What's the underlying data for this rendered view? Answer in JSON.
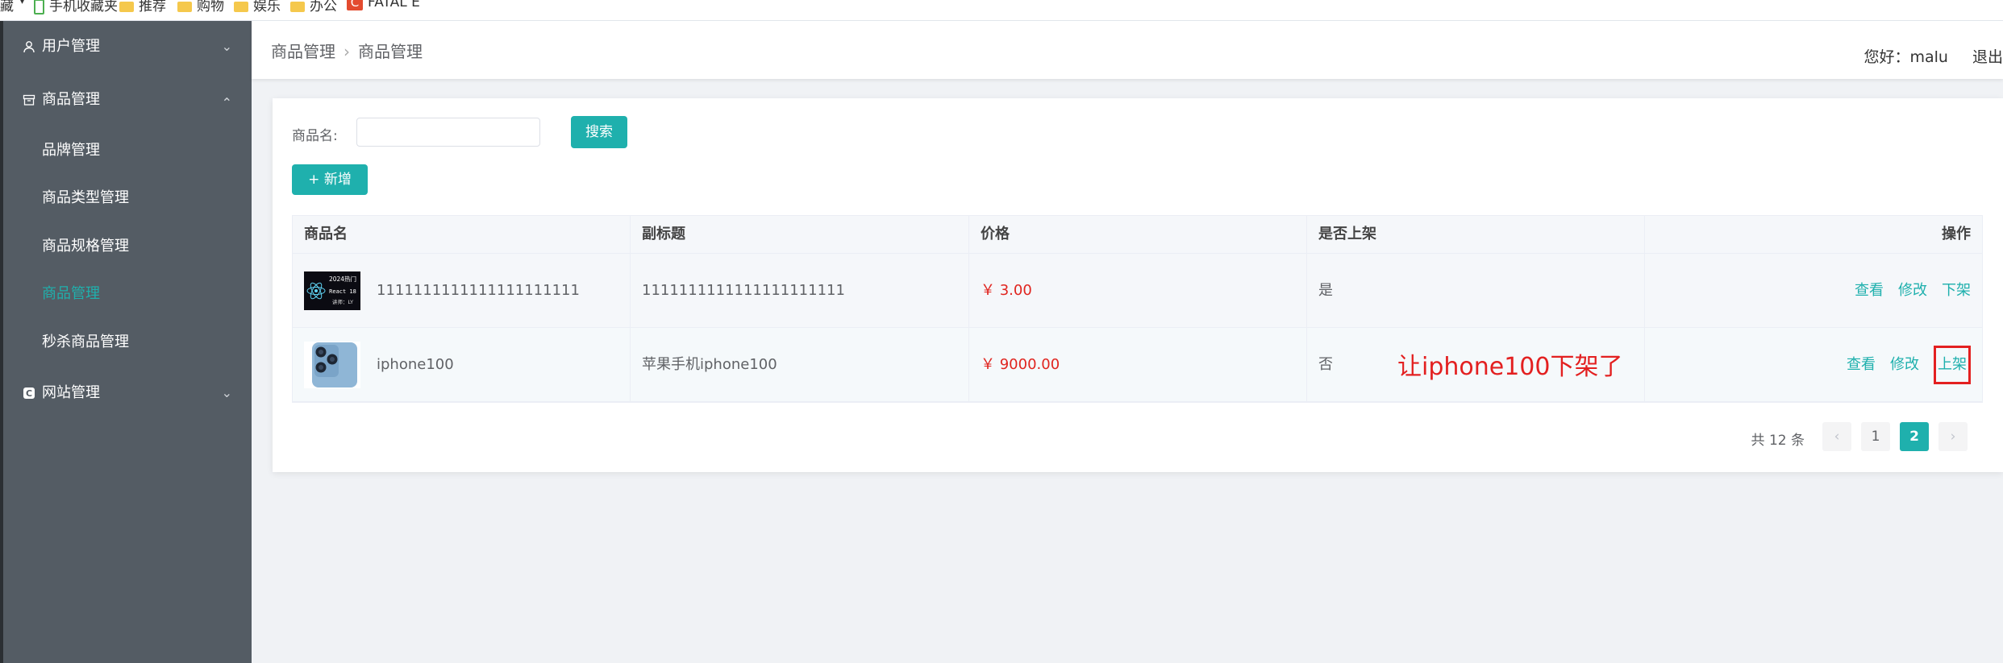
{
  "bookmarks": [
    {
      "label": "藏",
      "type": "text"
    },
    {
      "label": "手机收藏夹",
      "type": "phone"
    },
    {
      "label": "推荐",
      "type": "folder"
    },
    {
      "label": "购物",
      "type": "folder"
    },
    {
      "label": "娱乐",
      "type": "folder"
    },
    {
      "label": "办公",
      "type": "folder"
    },
    {
      "label": "FATAL E",
      "type": "site"
    }
  ],
  "sidebar": {
    "menus": [
      {
        "label": "用户管理",
        "icon": "user-icon",
        "expanded": false
      },
      {
        "label": "商品管理",
        "icon": "box-icon",
        "expanded": true
      },
      {
        "label": "网站管理",
        "icon": "website-icon",
        "expanded": false
      }
    ],
    "sub_items": [
      {
        "label": "品牌管理",
        "active": false
      },
      {
        "label": "商品类型管理",
        "active": false
      },
      {
        "label": "商品规格管理",
        "active": false
      },
      {
        "label": "商品管理",
        "active": true
      },
      {
        "label": "秒杀商品管理",
        "active": false
      }
    ],
    "active_color": "#1fb0ad"
  },
  "header": {
    "breadcrumb": [
      "商品管理",
      "商品管理"
    ],
    "greeting": "您好：malu",
    "logout": "退出"
  },
  "search": {
    "label": "商品名:",
    "value": "",
    "button": "搜索"
  },
  "add_button": "+ 新增",
  "table": {
    "columns": [
      "商品名",
      "副标题",
      "价格",
      "是否上架",
      "操作"
    ],
    "rows": [
      {
        "name": "1111111111111111111111",
        "subtitle": "1111111111111111111111",
        "price": "￥ 3.00",
        "on_sale": "是",
        "actions": [
          "查看",
          "修改",
          "下架"
        ],
        "thumb_text": [
          "2024热门",
          "React 18",
          "讲师：LY"
        ]
      },
      {
        "name": "iphone100",
        "subtitle": "苹果手机iphone100",
        "price": "￥ 9000.00",
        "on_sale": "否",
        "actions": [
          "查看",
          "修改",
          "上架"
        ]
      }
    ]
  },
  "annotation": "让iphone100下架了",
  "pagination": {
    "total": "共 12 条",
    "prev": "‹",
    "pages": [
      "1",
      "2"
    ],
    "current": "2",
    "next": "›"
  },
  "colors": {
    "accent": "#1fb0ad",
    "price": "#e0251f",
    "annotation": "#e32020",
    "sidebar": "#545c64"
  }
}
